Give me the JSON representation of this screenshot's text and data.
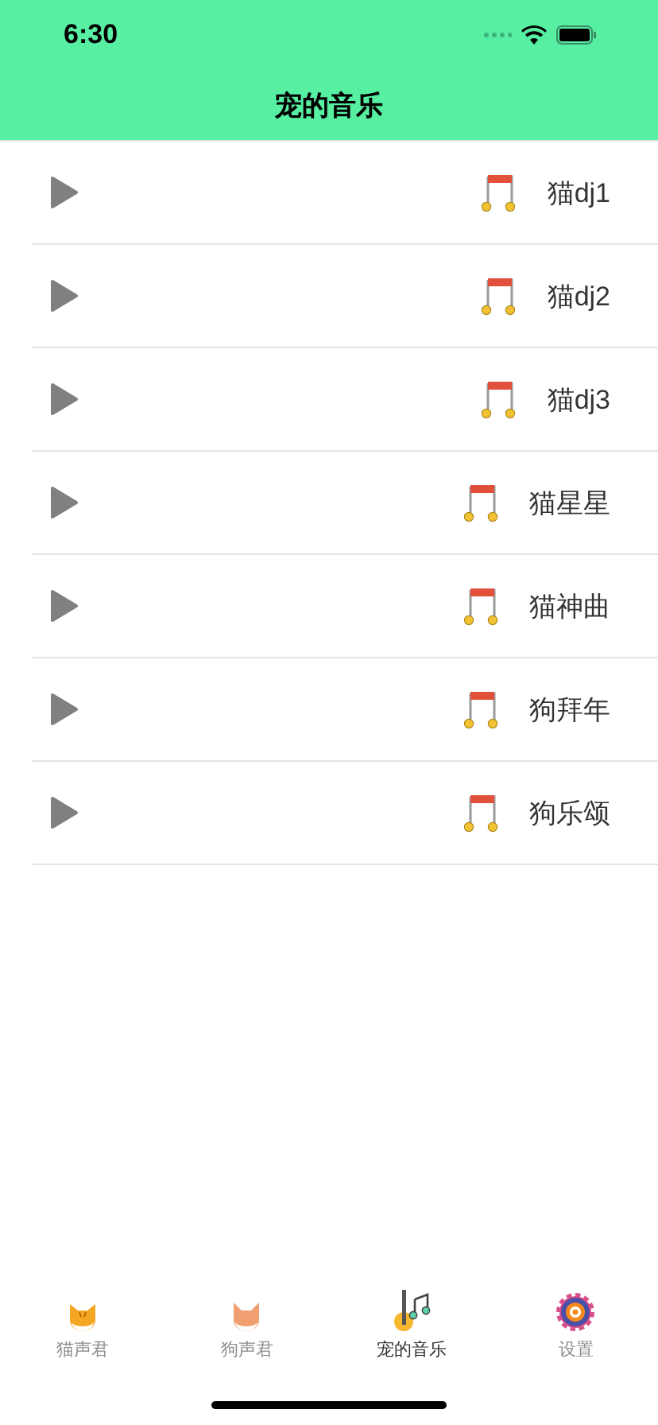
{
  "status_bar": {
    "time": "6:30"
  },
  "nav_bar": {
    "title": "宠的音乐"
  },
  "songs": [
    {
      "title": "猫dj1"
    },
    {
      "title": "猫dj2"
    },
    {
      "title": "猫dj3"
    },
    {
      "title": "猫星星"
    },
    {
      "title": "猫神曲"
    },
    {
      "title": "狗拜年"
    },
    {
      "title": "狗乐颂"
    }
  ],
  "tab_bar": [
    {
      "label": "猫声君",
      "kind": "cat",
      "selected": false
    },
    {
      "label": "狗声君",
      "kind": "dog",
      "selected": false
    },
    {
      "label": "宠的音乐",
      "kind": "music",
      "selected": true
    },
    {
      "label": "设置",
      "kind": "settings",
      "selected": false
    }
  ]
}
